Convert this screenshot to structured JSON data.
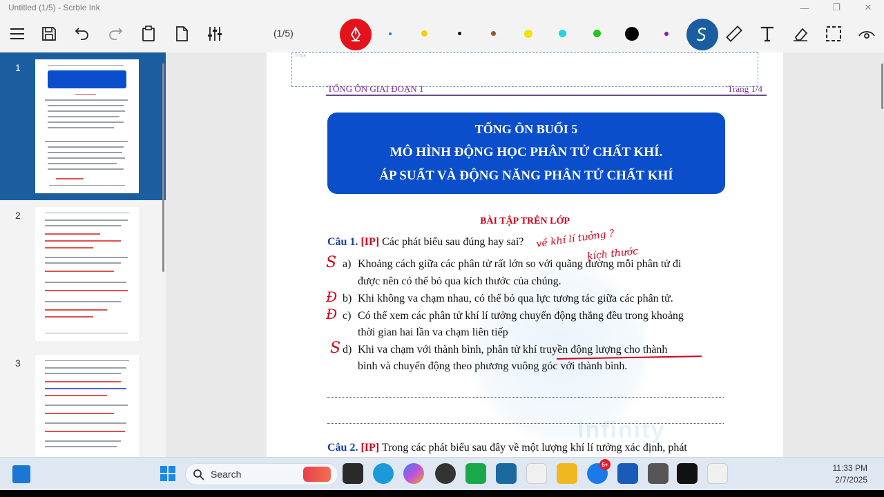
{
  "window": {
    "title": "Untitled (1/5) - Scrble Ink"
  },
  "toolbar": {
    "page_indicator": "(1/5)",
    "colors": [
      "#2a7ad0",
      "#f2d100",
      "#111111",
      "#a0522d",
      "#f2e600",
      "#22d3e6",
      "#22c61c",
      "#000000",
      "#8a1aa0"
    ]
  },
  "sidebar": {
    "thumbnails": [
      {
        "number": "1"
      },
      {
        "number": "2"
      },
      {
        "number": "3"
      }
    ]
  },
  "document": {
    "box_label": "TITLE",
    "header_left": "TỔNG ÔN GIAI ĐOẠN 1",
    "header_right": "Trang 1/4",
    "banner": {
      "line1": "TỔNG ÔN BUỔI 5",
      "line2": "MÔ HÌNH ĐỘNG HỌC PHÂN TỬ CHẤT KHÍ.",
      "line3": "ÁP SUẤT VÀ ĐỘNG NĂNG PHÂN TỬ CHẤT KHÍ"
    },
    "section_title": "BÀI TẬP TRÊN LỚP",
    "watermark": "Infinity",
    "q1": {
      "number": "Câu 1.",
      "tag": "[IP]",
      "text": "Các phát biểu sau đúng hay sai?",
      "options": [
        {
          "label": "a)",
          "line1": "Khoảng cách giữa các phân tử rất lớn so với quãng đường mỗi phân tử đi",
          "line2": "được nên có thể bỏ qua kích thước của chúng.",
          "mark": "S"
        },
        {
          "label": "b)",
          "line1": "Khi không va chạm nhau, có thể bỏ qua lực tương tác giữa các phân tử.",
          "line2": "",
          "mark": "Đ"
        },
        {
          "label": "c)",
          "line1": "Có thể xem các phân tử khí lí tưởng chuyển động thẳng đều trong khoảng",
          "line2": "thời gian hai lần va chạm liên tiếp",
          "mark": "Đ"
        },
        {
          "label": "d)",
          "line1": "Khi va chạm với thành bình, phân tử khí truyền động lượng cho thành",
          "line2": "bình và chuyển động theo phương vuông góc với thành bình.",
          "mark": "S"
        }
      ],
      "handwriting": [
        "về khí lí tưởng ?",
        "kích thước"
      ]
    },
    "q2": {
      "number": "Câu 2.",
      "tag": "[IP]",
      "text": "Trong các phát biểu sau đây về một lượng khí lí tưởng xác định, phát"
    }
  },
  "taskbar": {
    "search_label": "Search",
    "time": "11:33 PM",
    "date": "2/7/2025",
    "zalo_badge": "5+"
  }
}
